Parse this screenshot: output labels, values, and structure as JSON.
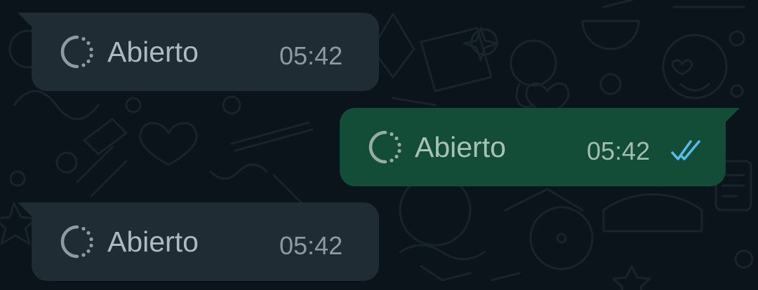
{
  "colors": {
    "background": "#0b141a",
    "incoming_bubble": "#202c33",
    "outgoing_bubble": "#144d37",
    "read_ticks": "#53bdeb",
    "wallpaper_doodle": "#1a262d"
  },
  "messages": [
    {
      "direction": "incoming",
      "status_icon": "status-ring-icon",
      "text": "Abierto",
      "time": "05:42"
    },
    {
      "direction": "outgoing",
      "status_icon": "status-ring-icon",
      "text": "Abierto",
      "time": "05:42",
      "receipt_icon": "double-check-read-icon"
    },
    {
      "direction": "incoming",
      "status_icon": "status-ring-icon",
      "text": "Abierto",
      "time": "05:42"
    }
  ]
}
